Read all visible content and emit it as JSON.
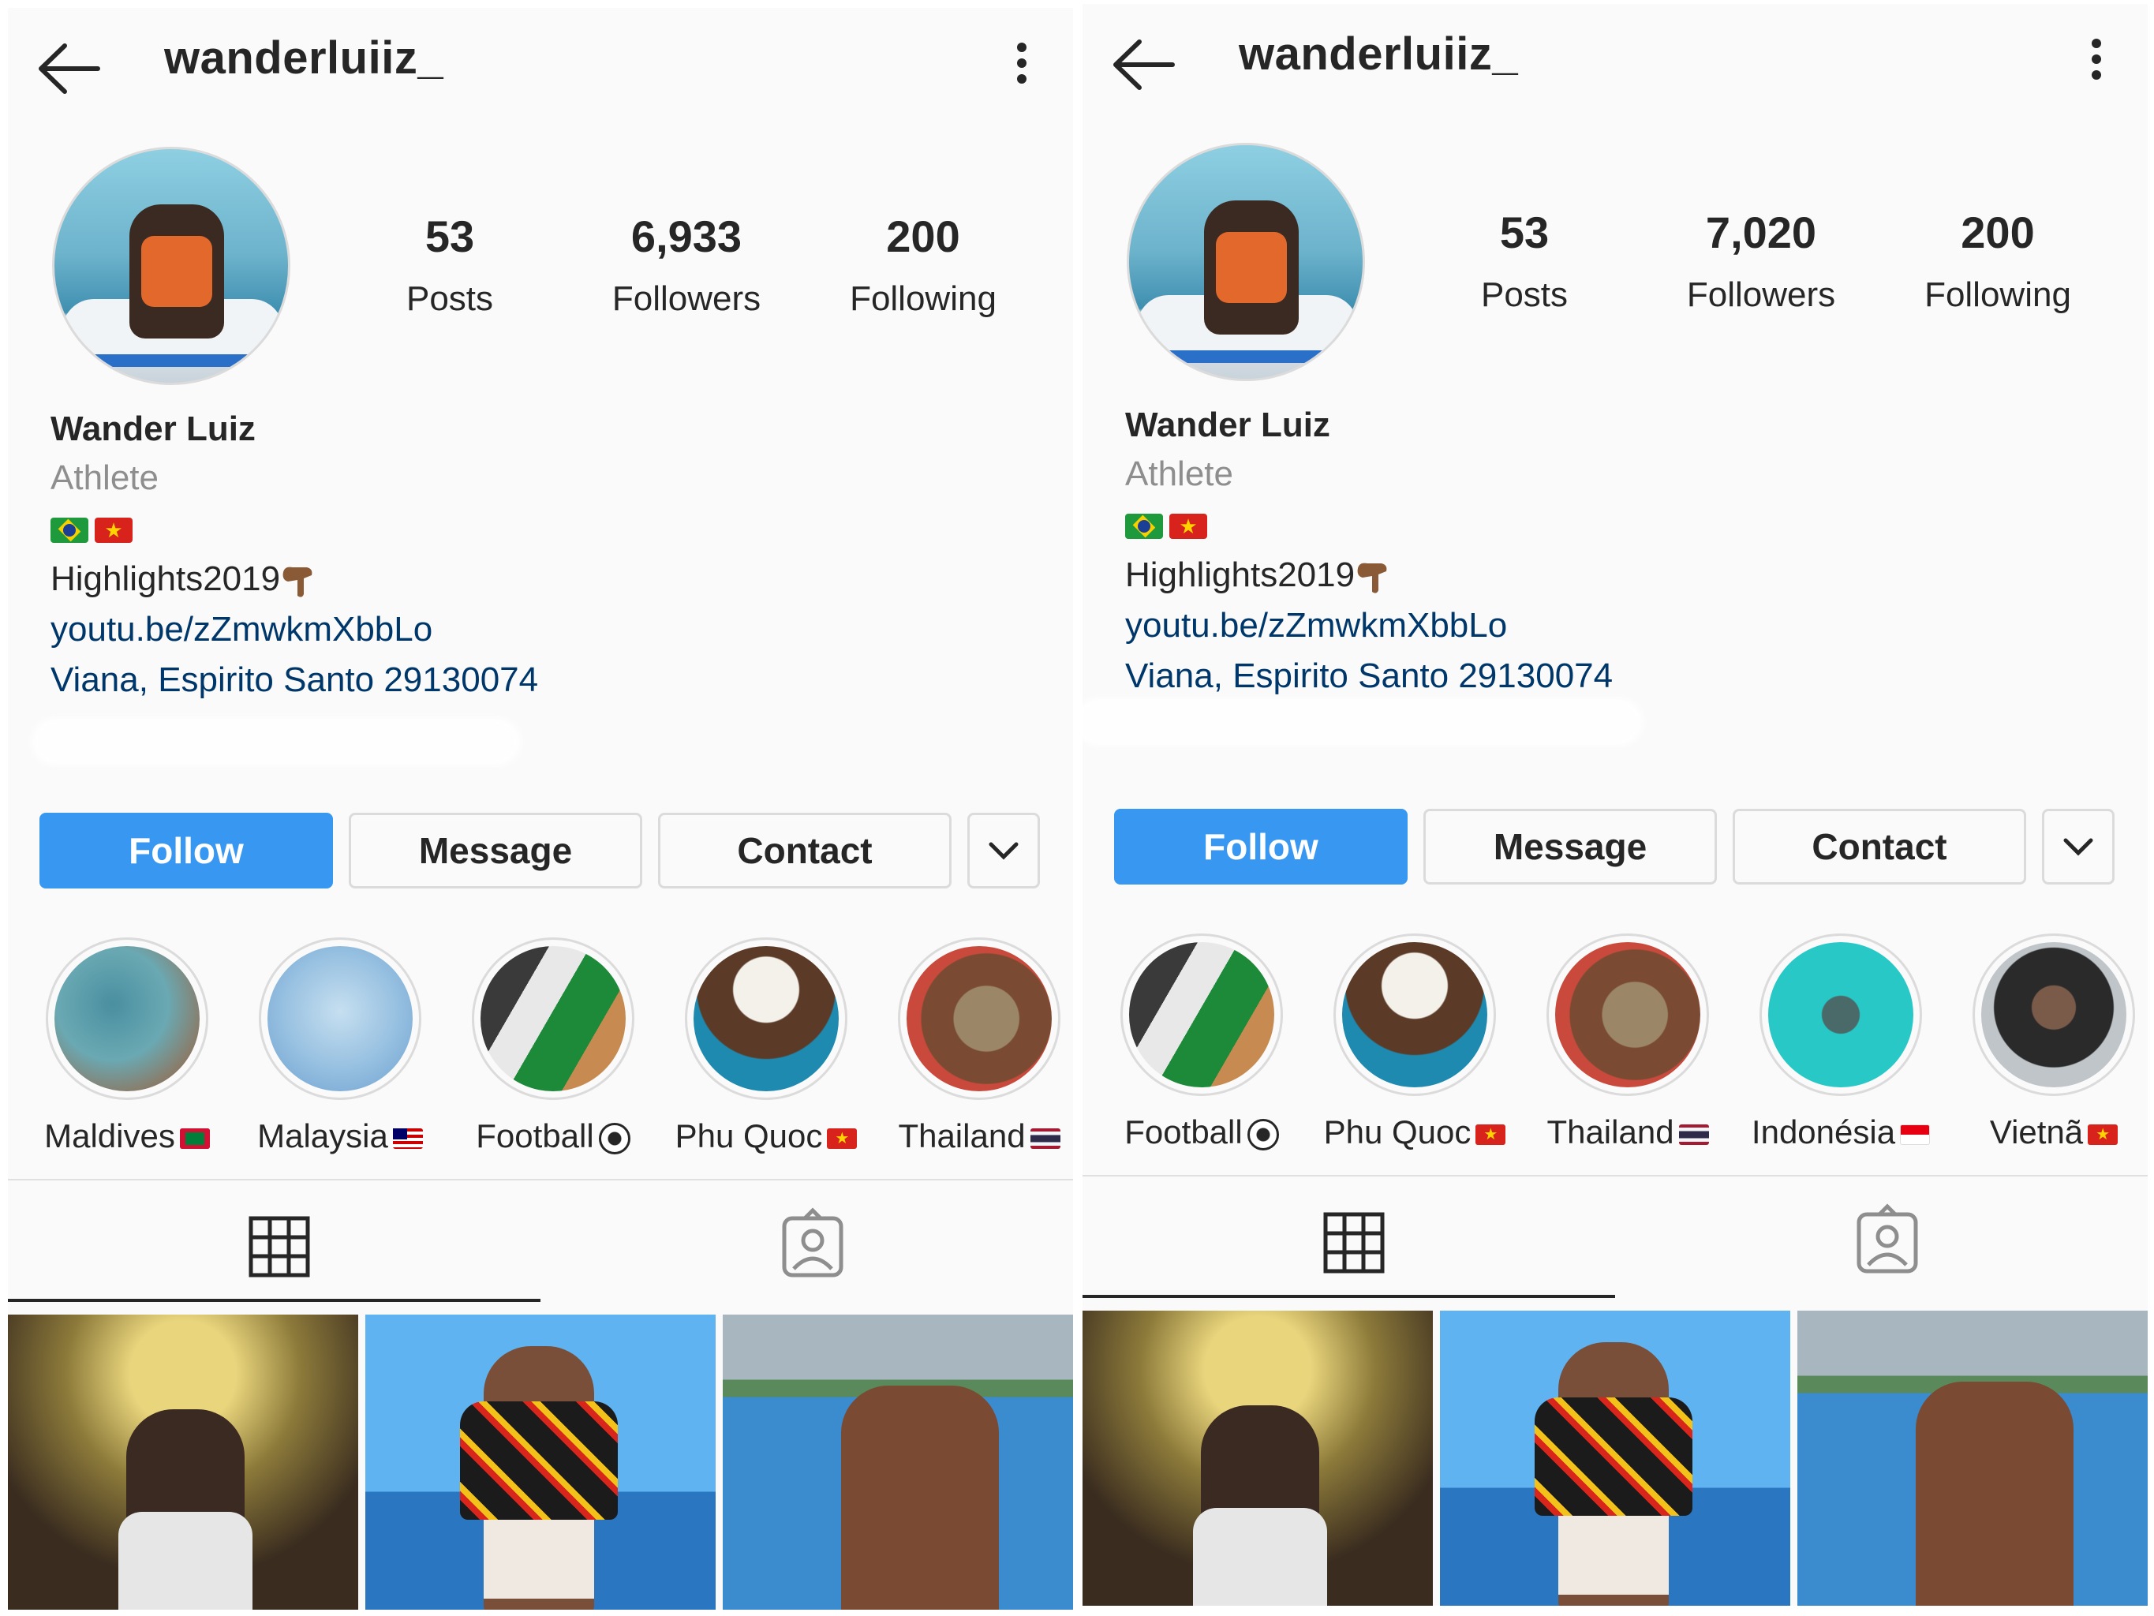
{
  "panels": [
    {
      "header": {
        "username": "wanderluiiz_"
      },
      "stats": {
        "posts": {
          "count": "53",
          "label": "Posts"
        },
        "followers": {
          "count": "6,933",
          "label": "Followers"
        },
        "following": {
          "count": "200",
          "label": "Following"
        }
      },
      "bio": {
        "name": "Wander Luiz",
        "category": "Athlete",
        "highlights_text": "Highlights2019",
        "link": "youtu.be/zZmwkmXbbLo",
        "address": "Viana, Espirito Santo 29130074"
      },
      "buttons": {
        "follow": "Follow",
        "message": "Message",
        "contact": "Contact"
      },
      "highlights": [
        {
          "label": "Maldives",
          "flag": "maldives-flag"
        },
        {
          "label": "Malaysia",
          "flag": "malaysia-flag"
        },
        {
          "label": "Football",
          "flag": "soccer-ball"
        },
        {
          "label": "Phu Quoc",
          "flag": "vietnam-flag"
        },
        {
          "label": "Thailand",
          "flag": "thailand-flag"
        }
      ]
    },
    {
      "header": {
        "username": "wanderluiiz_"
      },
      "stats": {
        "posts": {
          "count": "53",
          "label": "Posts"
        },
        "followers": {
          "count": "7,020",
          "label": "Followers"
        },
        "following": {
          "count": "200",
          "label": "Following"
        }
      },
      "bio": {
        "name": "Wander Luiz",
        "category": "Athlete",
        "highlights_text": "Highlights2019",
        "link": "youtu.be/zZmwkmXbbLo",
        "address": "Viana, Espirito Santo 29130074"
      },
      "buttons": {
        "follow": "Follow",
        "message": "Message",
        "contact": "Contact"
      },
      "highlights": [
        {
          "label": "Football",
          "flag": "soccer-ball"
        },
        {
          "label": "Phu Quoc",
          "flag": "vietnam-flag"
        },
        {
          "label": "Thailand",
          "flag": "thailand-flag"
        },
        {
          "label": "Indonésia",
          "flag": "indonesia-flag"
        },
        {
          "label": "Vietnã",
          "flag": "vietnam-flag"
        }
      ]
    }
  ],
  "colors": {
    "follow_button": "#3897f0",
    "link": "#00376b",
    "secondary_text": "#8e8e8e"
  },
  "icons": [
    "back-arrow-icon",
    "more-options-icon",
    "chevron-down-icon",
    "grid-icon",
    "tagged-icon",
    "pointing-down-emoji"
  ]
}
